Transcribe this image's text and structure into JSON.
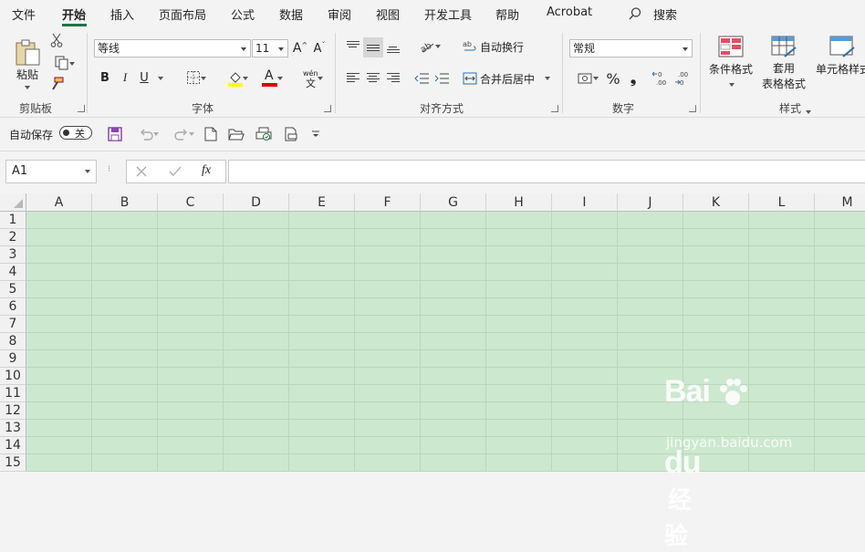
{
  "tabs": [
    "文件",
    "开始",
    "插入",
    "页面布局",
    "公式",
    "数据",
    "审阅",
    "视图",
    "开发工具",
    "帮助",
    "Acrobat"
  ],
  "search_label": "搜索",
  "ribbon": {
    "clipboard": {
      "paste_label": "粘贴",
      "group_label": "剪贴板"
    },
    "font": {
      "font_name": "等线",
      "font_size": "11",
      "group_label": "字体",
      "bold": "B",
      "italic": "I",
      "underline": "U",
      "grow": "A",
      "shrink": "A",
      "font_color_glyph": "A",
      "phonetic": "wén"
    },
    "alignment": {
      "wrap_label": "自动换行",
      "merge_label": "合并后居中",
      "group_label": "对齐方式"
    },
    "number": {
      "format": "常规",
      "group_label": "数字",
      "percent": "%",
      "comma": "❟"
    },
    "styles": {
      "conditional_label": "条件格式",
      "table_label_1": "套用",
      "table_label_2": "表格格式",
      "cell_label": "单元格样式",
      "group_label": "样式"
    }
  },
  "qat": {
    "autosave_label": "自动保存",
    "toggle_state": "关"
  },
  "formula_bar": {
    "name_box": "A1",
    "fx": "fx",
    "formula": ""
  },
  "sheet": {
    "columns": [
      "A",
      "B",
      "C",
      "D",
      "E",
      "F",
      "G",
      "H",
      "I",
      "J",
      "K",
      "L",
      "M"
    ],
    "rows": [
      "1",
      "2",
      "3",
      "4",
      "5",
      "6",
      "7",
      "8",
      "9",
      "10",
      "11",
      "12",
      "13",
      "14",
      "15"
    ]
  },
  "watermark": {
    "brand_1": "Bai",
    "brand_2": "du",
    "brand_cn": "经验",
    "url": "jingyan.baidu.com"
  },
  "colors": {
    "accent": "#217346",
    "sheet_bg": "#cce8cf"
  }
}
